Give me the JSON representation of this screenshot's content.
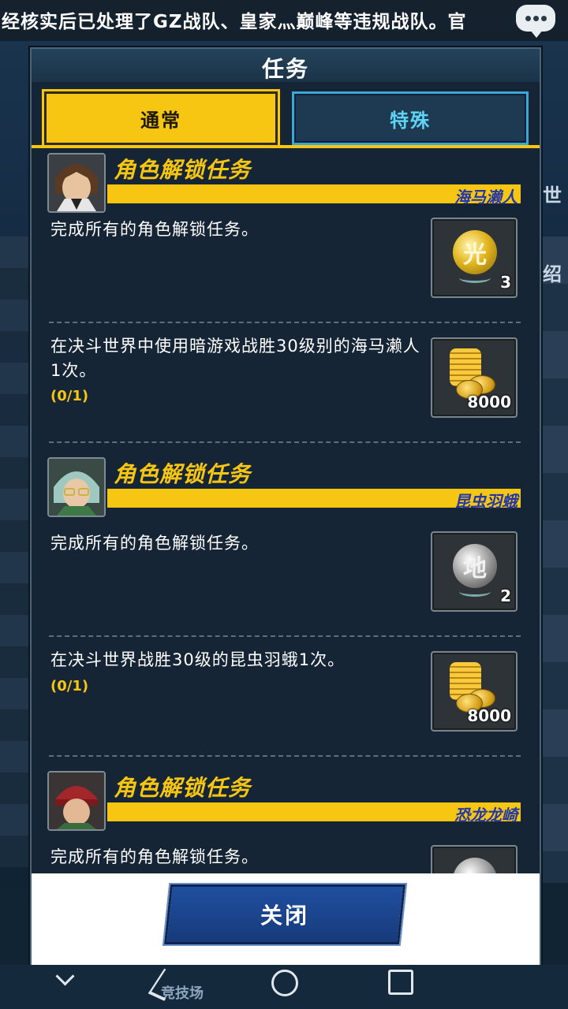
{
  "marquee": {
    "text": "经核实后已处理了GZ战队、皇家灬巅峰等违规战队。官"
  },
  "background": {
    "side_chars": [
      "世",
      "绍"
    ],
    "nav_label": "竞技场"
  },
  "dialog": {
    "title": "任务",
    "tabs": [
      {
        "label": "通常",
        "active": true
      },
      {
        "label": "特殊",
        "active": false
      }
    ],
    "groups": [
      {
        "title": "角色解锁任务",
        "character": "海马濑人",
        "avatar_icon": "kaiba-avatar",
        "tasks": [
          {
            "text": "完成所有的角色解锁任务。",
            "progress": "",
            "reward": {
              "icon": "light-orb-icon",
              "glyph": "光",
              "count": "3"
            }
          },
          {
            "text": "在决斗世界中使用暗游戏战胜30级别的海马濑人1次。",
            "progress": "(0/1)",
            "reward": {
              "icon": "gold-coins-icon",
              "count": "8000"
            }
          }
        ]
      },
      {
        "title": "角色解锁任务",
        "character": "昆虫羽蛾",
        "avatar_icon": "weevil-avatar",
        "tasks": [
          {
            "text": "完成所有的角色解锁任务。",
            "progress": "",
            "reward": {
              "icon": "earth-orb-icon",
              "glyph": "地",
              "count": "2"
            }
          },
          {
            "text": "在决斗世界战胜30级的昆虫羽蛾1次。",
            "progress": "(0/1)",
            "reward": {
              "icon": "gold-coins-icon",
              "count": "8000"
            }
          }
        ]
      },
      {
        "title": "角色解锁任务",
        "character": "恐龙龙崎",
        "avatar_icon": "rex-avatar",
        "tasks": [
          {
            "text": "完成所有的角色解锁任务。",
            "progress": "",
            "reward": {
              "icon": "orb-icon",
              "glyph": "",
              "count": ""
            }
          }
        ]
      }
    ],
    "close_label": "关闭"
  },
  "colors": {
    "accent": "#f6c613",
    "name_text": "#2136a8",
    "tab_special_text": "#5fd3f5",
    "button": "#1f4fa0"
  }
}
